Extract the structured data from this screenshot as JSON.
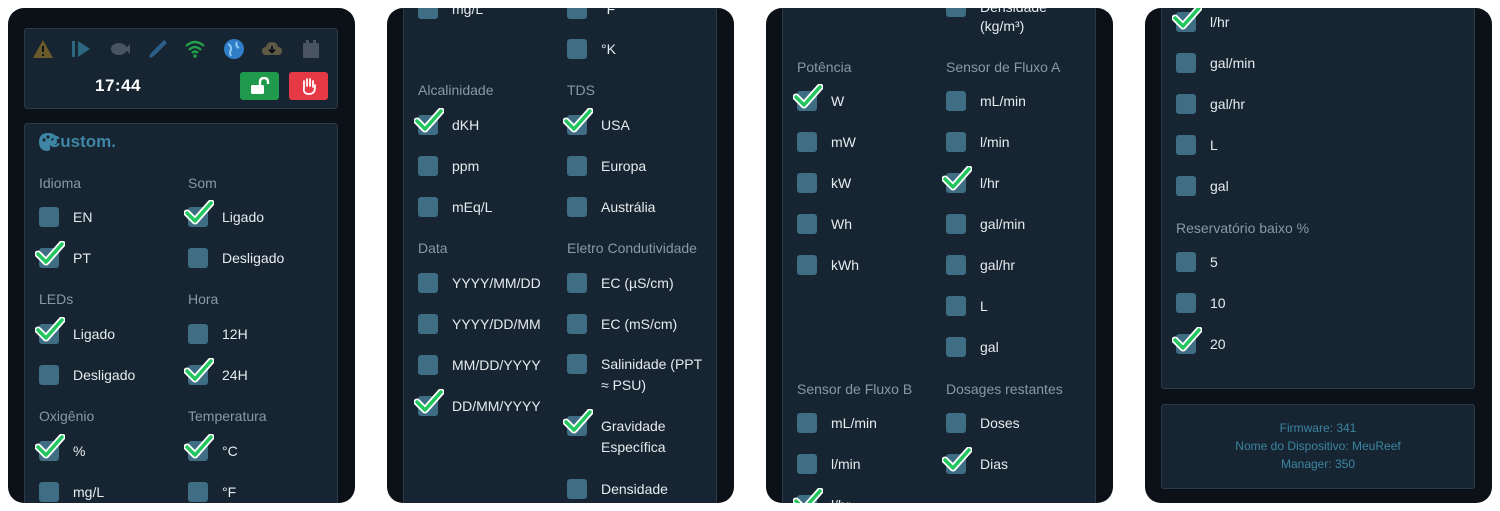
{
  "colors": {
    "background": "#0b1117",
    "card": "#172431",
    "card_border": "#2a3a48",
    "accent": "#3e86a4",
    "checkbox": "#3e6d84",
    "check": "#22c55e",
    "unlock_button": "#1f9a4c",
    "stop_button": "#e53945",
    "muted_text": "#8a99a6"
  },
  "status_bar": {
    "icons": [
      "warning-icon",
      "play-icon",
      "fish-icon",
      "pipette-icon",
      "wifi-icon",
      "globe-icon",
      "cloud-download-icon",
      "battery-icon"
    ],
    "time": "17:44",
    "unlock_icon": "unlock-icon",
    "stop_icon": "hand-stop-icon"
  },
  "custom": {
    "title": "Custom.",
    "icon": "palette-icon",
    "sections": {
      "idioma": {
        "label": "Idioma",
        "options": [
          {
            "label": "EN",
            "checked": false
          },
          {
            "label": "PT",
            "checked": true
          }
        ]
      },
      "som": {
        "label": "Som",
        "options": [
          {
            "label": "Ligado",
            "checked": true
          },
          {
            "label": "Desligado",
            "checked": false
          }
        ]
      },
      "leds": {
        "label": "LEDs",
        "options": [
          {
            "label": "Ligado",
            "checked": true
          },
          {
            "label": "Desligado",
            "checked": false
          }
        ]
      },
      "hora": {
        "label": "Hora",
        "options": [
          {
            "label": "12H",
            "checked": false
          },
          {
            "label": "24H",
            "checked": true
          }
        ]
      },
      "oxigenio": {
        "label": "Oxigênio",
        "options": [
          {
            "label": "%",
            "checked": true
          },
          {
            "label": "mg/L",
            "checked": false
          }
        ]
      },
      "temperatura": {
        "label": "Temperatura",
        "options": [
          {
            "label": "°C",
            "checked": true
          },
          {
            "label": "°F",
            "checked": false
          },
          {
            "label": "°K",
            "checked": false
          }
        ]
      },
      "alcalinidade": {
        "label": "Alcalinidade",
        "options": [
          {
            "label": "dKH",
            "checked": true
          },
          {
            "label": "ppm",
            "checked": false
          },
          {
            "label": "mEq/L",
            "checked": false
          }
        ]
      },
      "tds": {
        "label": "TDS",
        "options": [
          {
            "label": "USA",
            "checked": true
          },
          {
            "label": "Europa",
            "checked": false
          },
          {
            "label": "Austrália",
            "checked": false
          }
        ]
      },
      "data": {
        "label": "Data",
        "options": [
          {
            "label": "YYYY/MM/DD",
            "checked": false
          },
          {
            "label": "YYYY/DD/MM",
            "checked": false
          },
          {
            "label": "MM/DD/YYYY",
            "checked": false
          },
          {
            "label": "DD/MM/YYYY",
            "checked": true
          }
        ]
      },
      "eletro": {
        "label": "Eletro Condutividade",
        "options": [
          {
            "label": "EC (µS/cm)",
            "checked": false
          },
          {
            "label": "EC (mS/cm)",
            "checked": false
          },
          {
            "label": "Salinidade (PPT ≈ PSU)",
            "checked": false
          },
          {
            "label": "Gravidade Específica",
            "checked": true
          },
          {
            "label": "Densidade",
            "checked": false
          }
        ]
      },
      "densidade_unit": {
        "label": "(kg/m³)"
      },
      "potencia": {
        "label": "Potência",
        "options": [
          {
            "label": "W",
            "checked": true
          },
          {
            "label": "mW",
            "checked": false
          },
          {
            "label": "kW",
            "checked": false
          },
          {
            "label": "Wh",
            "checked": false
          },
          {
            "label": "kWh",
            "checked": false
          }
        ]
      },
      "fluxo_a": {
        "label": "Sensor de Fluxo A",
        "options": [
          {
            "label": "mL/min",
            "checked": false
          },
          {
            "label": "l/min",
            "checked": false
          },
          {
            "label": "l/hr",
            "checked": true
          },
          {
            "label": "gal/min",
            "checked": false
          },
          {
            "label": "gal/hr",
            "checked": false
          },
          {
            "label": "L",
            "checked": false
          },
          {
            "label": "gal",
            "checked": false
          }
        ]
      },
      "fluxo_b": {
        "label": "Sensor de Fluxo B",
        "options": [
          {
            "label": "mL/min",
            "checked": false
          },
          {
            "label": "l/min",
            "checked": false
          },
          {
            "label": "l/hr",
            "checked": true
          },
          {
            "label": "gal/min",
            "checked": false
          },
          {
            "label": "gal/hr",
            "checked": false
          },
          {
            "label": "L",
            "checked": false
          },
          {
            "label": "gal",
            "checked": false
          }
        ]
      },
      "dosagens": {
        "label": "Dosages restantes",
        "options": [
          {
            "label": "Doses",
            "checked": false
          },
          {
            "label": "Dias",
            "checked": true
          }
        ]
      },
      "reservatorio": {
        "label": "Reservatório baixo %",
        "options": [
          {
            "label": "5",
            "checked": false
          },
          {
            "label": "10",
            "checked": false
          },
          {
            "label": "20",
            "checked": true
          }
        ]
      }
    }
  },
  "footer": {
    "firmware": "Firmware: 341",
    "device_name": "Nome do Dispositivo: MeuReef",
    "manager": "Manager: 350"
  }
}
